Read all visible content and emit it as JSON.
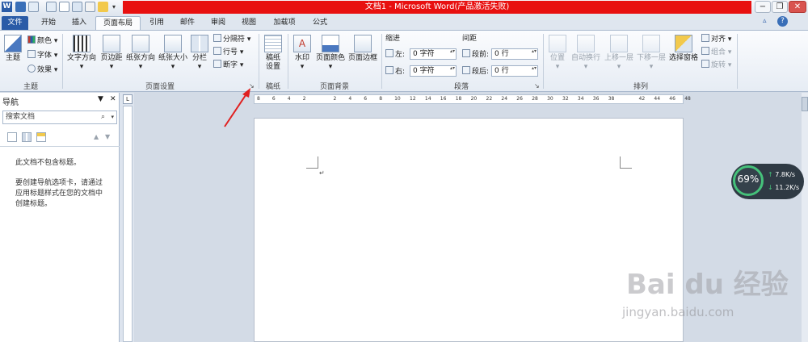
{
  "title_bar": {
    "title": "文档1 - Microsoft Word(产品激活失败)",
    "app_icon": "W"
  },
  "tabs": [
    "文件",
    "开始",
    "插入",
    "页面布局",
    "引用",
    "邮件",
    "审阅",
    "视图",
    "加载项",
    "公式"
  ],
  "active_tab": "页面布局",
  "ribbon": {
    "theme_group": {
      "label": "主题",
      "theme": "主题",
      "colors": "颜色",
      "fonts": "字体",
      "effects": "效果"
    },
    "page_setup": {
      "label": "页面设置",
      "text_direction": "文字方向",
      "margins": "页边距",
      "orientation": "纸张方向",
      "size": "纸张大小",
      "columns": "分栏",
      "breaks": "分隔符",
      "line_numbers": "行号",
      "hyphenation": "断字"
    },
    "manuscript": {
      "label": "稿纸",
      "settings": "稿纸\n设置",
      "settings_l1": "稿纸",
      "settings_l2": "设置"
    },
    "page_background": {
      "label": "页面背景",
      "watermark": "水印",
      "page_color": "页面颜色",
      "page_borders": "页面边框"
    },
    "paragraph": {
      "label": "段落",
      "indent_title": "缩进",
      "spacing_title": "间距",
      "left_label": "左:",
      "right_label": "右:",
      "left_value": "0 字符",
      "right_value": "0 字符",
      "before_label": "段前:",
      "after_label": "段后:",
      "before_value": "0 行",
      "after_value": "0 行"
    },
    "arrange": {
      "label": "排列",
      "position": "位置",
      "wrap_text": "自动换行",
      "bring_forward": "上移一层",
      "send_backward": "下移一层",
      "selection_pane": "选择窗格",
      "align": "对齐",
      "group": "组合",
      "rotate": "旋转"
    }
  },
  "nav_pane": {
    "title": "导航",
    "search_placeholder": "搜索文档",
    "empty_msg": "此文档不包含标题。",
    "hint_l1": "要创建导航选项卡，请通过",
    "hint_l2": "应用标题样式在您的文档中",
    "hint_l3": "创建标题。"
  },
  "ruler": {
    "h_numbers": [
      "8",
      "6",
      "4",
      "2",
      "",
      "2",
      "4",
      "6",
      "8",
      "10",
      "12",
      "14",
      "16",
      "18",
      "20",
      "22",
      "24",
      "26",
      "28",
      "30",
      "32",
      "34",
      "36",
      "38",
      "",
      "42",
      "44",
      "46",
      "48"
    ]
  },
  "speed_widget": {
    "percent": "69%",
    "up": "7.8K/s",
    "down": "11.2K/s"
  },
  "watermark": {
    "brand": "Bai du 经验",
    "url": "jingyan.baidu.com"
  },
  "colors": {
    "title_red": "#e81010",
    "file_tab": "#2a5ba7",
    "arrow": "#e02020",
    "speed_green": "#45c17a"
  }
}
